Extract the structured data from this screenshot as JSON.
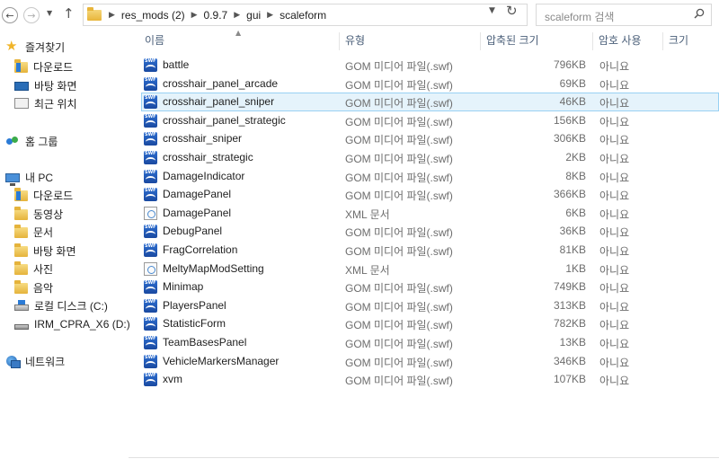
{
  "address": {
    "crumbs": [
      "res_mods (2)",
      "0.9.7",
      "gui",
      "scaleform"
    ],
    "search_placeholder": "scaleform 검색"
  },
  "nav": {
    "favorites": "즐겨찾기",
    "fav_items": [
      "다운로드",
      "바탕 화면",
      "최근 위치"
    ],
    "homegroup": "홈 그룹",
    "this_pc": "내 PC",
    "pc_items": [
      "다운로드",
      "동영상",
      "문서",
      "바탕 화면",
      "사진",
      "음악",
      "로컬 디스크 (C:)",
      "IRM_CPRA_X6 (D:)"
    ],
    "network": "네트워크"
  },
  "columns": {
    "name": "이름",
    "type": "유형",
    "compressed_size": "압축된 크기",
    "password": "암호 사용",
    "size": "크기"
  },
  "files": [
    {
      "name": "battle",
      "type": "GOM 미디어 파일(.swf)",
      "csize": "796KB",
      "pwd": "아니요",
      "icon": "swf"
    },
    {
      "name": "crosshair_panel_arcade",
      "type": "GOM 미디어 파일(.swf)",
      "csize": "69KB",
      "pwd": "아니요",
      "icon": "swf"
    },
    {
      "name": "crosshair_panel_sniper",
      "type": "GOM 미디어 파일(.swf)",
      "csize": "46KB",
      "pwd": "아니요",
      "icon": "swf",
      "selected": true
    },
    {
      "name": "crosshair_panel_strategic",
      "type": "GOM 미디어 파일(.swf)",
      "csize": "156KB",
      "pwd": "아니요",
      "icon": "swf"
    },
    {
      "name": "crosshair_sniper",
      "type": "GOM 미디어 파일(.swf)",
      "csize": "306KB",
      "pwd": "아니요",
      "icon": "swf"
    },
    {
      "name": "crosshair_strategic",
      "type": "GOM 미디어 파일(.swf)",
      "csize": "2KB",
      "pwd": "아니요",
      "icon": "swf"
    },
    {
      "name": "DamageIndicator",
      "type": "GOM 미디어 파일(.swf)",
      "csize": "8KB",
      "pwd": "아니요",
      "icon": "swf"
    },
    {
      "name": "DamagePanel",
      "type": "GOM 미디어 파일(.swf)",
      "csize": "366KB",
      "pwd": "아니요",
      "icon": "swf"
    },
    {
      "name": "DamagePanel",
      "type": "XML 문서",
      "csize": "6KB",
      "pwd": "아니요",
      "icon": "xml"
    },
    {
      "name": "DebugPanel",
      "type": "GOM 미디어 파일(.swf)",
      "csize": "36KB",
      "pwd": "아니요",
      "icon": "swf"
    },
    {
      "name": "FragCorrelation",
      "type": "GOM 미디어 파일(.swf)",
      "csize": "81KB",
      "pwd": "아니요",
      "icon": "swf"
    },
    {
      "name": "MeltyMapModSetting",
      "type": "XML 문서",
      "csize": "1KB",
      "pwd": "아니요",
      "icon": "xml"
    },
    {
      "name": "Minimap",
      "type": "GOM 미디어 파일(.swf)",
      "csize": "749KB",
      "pwd": "아니요",
      "icon": "swf"
    },
    {
      "name": "PlayersPanel",
      "type": "GOM 미디어 파일(.swf)",
      "csize": "313KB",
      "pwd": "아니요",
      "icon": "swf"
    },
    {
      "name": "StatisticForm",
      "type": "GOM 미디어 파일(.swf)",
      "csize": "782KB",
      "pwd": "아니요",
      "icon": "swf"
    },
    {
      "name": "TeamBasesPanel",
      "type": "GOM 미디어 파일(.swf)",
      "csize": "13KB",
      "pwd": "아니요",
      "icon": "swf"
    },
    {
      "name": "VehicleMarkersManager",
      "type": "GOM 미디어 파일(.swf)",
      "csize": "346KB",
      "pwd": "아니요",
      "icon": "swf"
    },
    {
      "name": "xvm",
      "type": "GOM 미디어 파일(.swf)",
      "csize": "107KB",
      "pwd": "아니요",
      "icon": "swf"
    }
  ]
}
